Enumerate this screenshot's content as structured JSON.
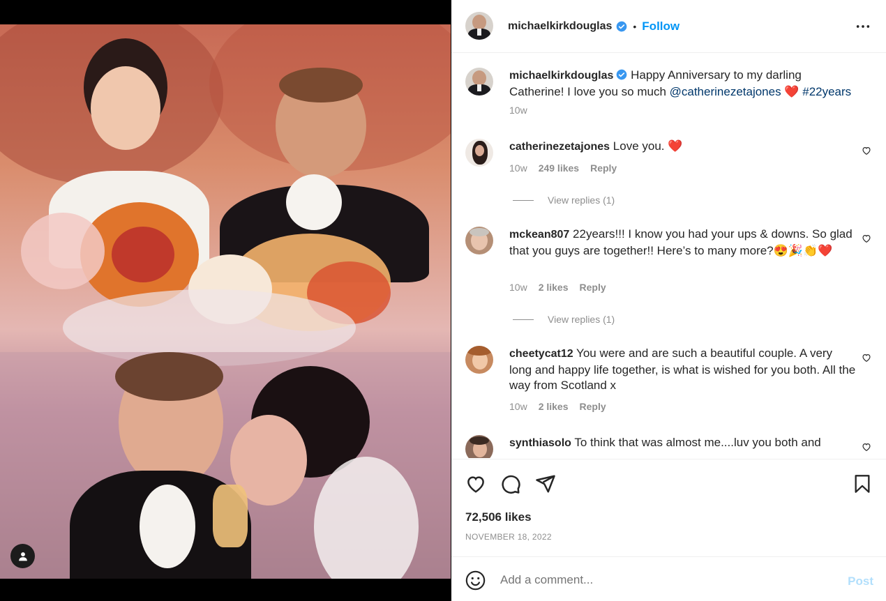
{
  "post": {
    "author": "michaelkirkdouglas",
    "follow_label": "Follow",
    "dot": "•",
    "more_label": "•••"
  },
  "caption": {
    "author": "michaelkirkdouglas",
    "text_before": "Happy Anniversary to my darling Catherine! I love you so much ",
    "mention": "@catherinezetajones",
    "emoji": "❤️",
    "hashtag": "#22years",
    "time": "10w"
  },
  "comments": [
    {
      "user": "catherinezetajones",
      "text": "Love you. ❤️",
      "time": "10w",
      "likes": "249 likes",
      "reply_label": "Reply",
      "view_replies": "View replies (1)"
    },
    {
      "user": "mckean807",
      "text": "22years!!! I know you had your ups & downs. So glad that you guys are together!! Here’s to many more?😍🎉👏❤️",
      "time": "10w",
      "likes": "2 likes",
      "reply_label": "Reply",
      "view_replies": "View replies (1)"
    },
    {
      "user": "cheetycat12",
      "text": "You were and are such a beautiful couple. A very long and happy life together, is what is wished for you both. All the way from Scotland x",
      "time": "10w",
      "likes": "2 likes",
      "reply_label": "Reply"
    },
    {
      "user": "synthiasolo",
      "text": "To think that was almost me....luv you both and"
    }
  ],
  "stats": {
    "likes": "72,506 likes",
    "date": "NOVEMBER 18, 2022"
  },
  "comment_box": {
    "placeholder": "Add a comment...",
    "post_label": "Post"
  },
  "colors": {
    "link": "#00376b",
    "follow": "#0095f6",
    "verified": "#3897f0",
    "heart": "#ed4956"
  },
  "icons": [
    "user-tag-icon",
    "verified-badge-icon",
    "more-options-icon",
    "heart-icon",
    "comment-icon",
    "share-icon",
    "bookmark-icon",
    "emoji-icon"
  ]
}
